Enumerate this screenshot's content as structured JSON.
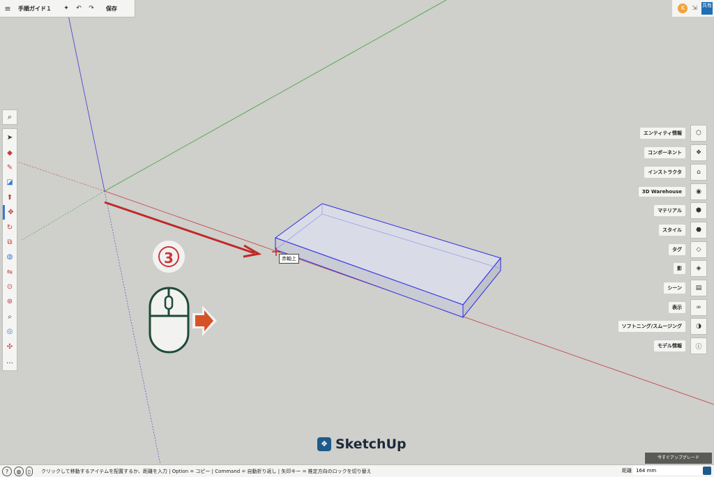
{
  "topbar": {
    "title": "手順ガイド１",
    "save_label": "保存"
  },
  "topright": {
    "avatar_initial": "K",
    "share_label": "共有"
  },
  "right_panel": {
    "items": [
      {
        "label": "エンティティ情報",
        "icon": "entity-info-icon"
      },
      {
        "label": "コンポーネント",
        "icon": "components-icon"
      },
      {
        "label": "インストラクタ",
        "icon": "instructor-icon"
      },
      {
        "label": "3D Warehouse",
        "icon": "warehouse-icon"
      },
      {
        "label": "マテリアル",
        "icon": "materials-icon"
      },
      {
        "label": "スタイル",
        "icon": "styles-icon"
      },
      {
        "label": "タグ",
        "icon": "tags-icon"
      },
      {
        "label": "影",
        "icon": "shadows-icon"
      },
      {
        "label": "シーン",
        "icon": "scenes-icon"
      },
      {
        "label": "表示",
        "icon": "display-icon"
      },
      {
        "label": "ソフトニング/スムージング",
        "icon": "soften-icon"
      },
      {
        "label": "モデル情報",
        "icon": "model-info-icon"
      }
    ]
  },
  "viewport": {
    "tooltip": "赤軸上",
    "step_number": "3"
  },
  "branding": {
    "logo_text": "SketchUp",
    "upgrade_label": "今すぐアップグレード"
  },
  "statusbar": {
    "hint": "クリックして移動するアイテムを配置するか、距離を入力 | Option = コピー | Command = 自動折り返し | 矢印キー = 推定方向のロックを切り替え",
    "distance_label": "距離",
    "distance_value": "164 mm"
  },
  "colors": {
    "axis_red": "#c63a3a",
    "axis_green": "#3aa53a",
    "axis_blue": "#3b3bd8",
    "selection_blue": "#2a2ae6",
    "arrow_red": "#c02828",
    "mouse_green": "#1e4a3a",
    "arrow_orange": "#d6532a",
    "accent": "#3a7bd5"
  }
}
